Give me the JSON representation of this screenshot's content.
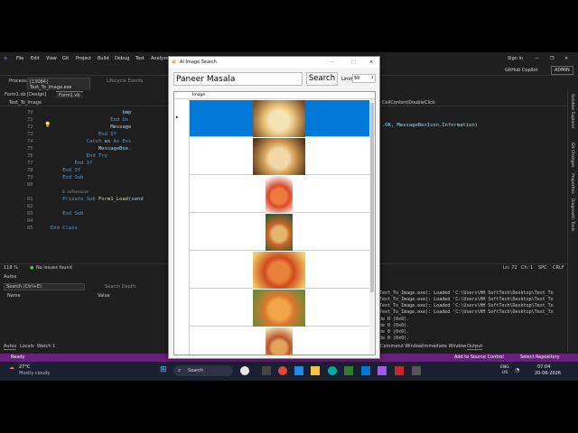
{
  "vs": {
    "menu": [
      "File",
      "Edit",
      "View",
      "Git",
      "Project",
      "Build",
      "Debug",
      "Test",
      "Analyze"
    ],
    "sign_in": "Sign in",
    "copilot": "GitHub Copilot",
    "admin": "ADMIN",
    "process_label": "Process:",
    "process_value": "[13084] Text_To_Image.exe",
    "lifecycle": "Lifecycle Events",
    "tabs": [
      "Form1.vb [Design]",
      "Form1.vb"
    ],
    "class_dropdown": "Text_To_Image",
    "event_dropdown": "CellContentDoubleClick",
    "code_right_fragment": ".OK, MessageBoxIcon.Information)",
    "line_numbers": [
      "70",
      "71",
      "72",
      "73",
      "74",
      "75",
      "76",
      "77",
      "78",
      "79",
      "80",
      "",
      "81",
      "82",
      "83",
      "84",
      "85"
    ],
    "code_lines": [
      {
        "indent": "                        ",
        "parts": [
          {
            "t": "bmp",
            "c": "id"
          }
        ]
      },
      {
        "indent": "                    ",
        "parts": [
          {
            "t": "End Us",
            "c": "kw"
          }
        ]
      },
      {
        "indent": "                    ",
        "parts": [
          {
            "t": "Message",
            "c": "id"
          }
        ]
      },
      {
        "indent": "                ",
        "parts": [
          {
            "t": "End If",
            "c": "kw"
          }
        ]
      },
      {
        "indent": "            ",
        "parts": [
          {
            "t": "Catch ",
            "c": "kw"
          },
          {
            "t": "ex ",
            "c": "id"
          },
          {
            "t": "As Exc",
            "c": "kw"
          }
        ]
      },
      {
        "indent": "                ",
        "parts": [
          {
            "t": "MessageBox.",
            "c": "id"
          }
        ]
      },
      {
        "indent": "            ",
        "parts": [
          {
            "t": "End Try",
            "c": "kw"
          }
        ]
      },
      {
        "indent": "        ",
        "parts": [
          {
            "t": "End If",
            "c": "kw"
          }
        ]
      },
      {
        "indent": "    ",
        "parts": [
          {
            "t": "End If",
            "c": "kw"
          }
        ]
      },
      {
        "indent": "    ",
        "parts": [
          {
            "t": "End Sub",
            "c": "kw"
          }
        ]
      },
      {
        "indent": "",
        "parts": []
      },
      {
        "indent": "    ",
        "parts": [
          {
            "t": "0 references",
            "c": "cmt"
          }
        ]
      },
      {
        "indent": "    ",
        "parts": [
          {
            "t": "Private Sub ",
            "c": "kw"
          },
          {
            "t": "Form1_Load",
            "c": "fn"
          },
          {
            "t": "(send",
            "c": "id"
          }
        ]
      },
      {
        "indent": "",
        "parts": []
      },
      {
        "indent": "    ",
        "parts": [
          {
            "t": "End Sub",
            "c": "kw"
          }
        ]
      },
      {
        "indent": "",
        "parts": []
      },
      {
        "indent": "",
        "parts": [
          {
            "t": "End Class",
            "c": "kw"
          }
        ]
      }
    ],
    "zoom": "118 %",
    "no_issues": "No issues found",
    "cursor": "Ln: 72",
    "col": "Ch: 1",
    "spc": "SPC",
    "crlf": "CRLF",
    "autos_title": "Autos",
    "autos_search_placeholder": "Search (Ctrl+E)",
    "search_depth": "Search Depth:",
    "autos_cols": [
      "Name",
      "Value"
    ],
    "bottom_tabs": [
      "Autos",
      "Locals",
      "Watch 1"
    ],
    "output_lines": [
      "Text_To_Image.exe): Loaded 'C:\\Users\\HH SoftTech\\Desktop\\Text_To",
      "Text_To_Image.exe): Loaded 'C:\\Users\\HH SoftTech\\Desktop\\Text_To",
      "Text_To_Image.exe): Loaded 'C:\\Users\\HH SoftTech\\Desktop\\Text_To",
      "Text_To_Image.exe): Loaded 'C:\\Users\\HH SoftTech\\Desktop\\Text_To",
      "de 0 (0x0).",
      "de 0 (0x0).",
      "de 0 (0x0).",
      "de 0 (0x0)."
    ],
    "output_tabs": [
      "Command Window",
      "Immediate Window",
      "Output"
    ],
    "status_ready": "Ready",
    "add_source": "Add to Source Control",
    "select_repo": "Select Repository",
    "rail": [
      "Solution Explorer",
      "Git Changes",
      "Properties",
      "Diagnostic Tools"
    ]
  },
  "dialog": {
    "title": "AI Image Search",
    "search_value": "Paneer Masala",
    "search_button": "Search",
    "limit_label": "Limit",
    "limit_value": "50",
    "column_header": "Image",
    "row_count": 7,
    "selected_row": 0
  },
  "taskbar": {
    "weather_temp": "27°C",
    "weather_desc": "Mostly cloudy",
    "search_label": "Search",
    "lang": "ENG",
    "region": "US",
    "time": "07:04",
    "date": "20-06-2026"
  },
  "colors": {
    "vs_purple": "#68217a",
    "selection_blue": "#0078d7",
    "accent": "#7a5cff"
  }
}
